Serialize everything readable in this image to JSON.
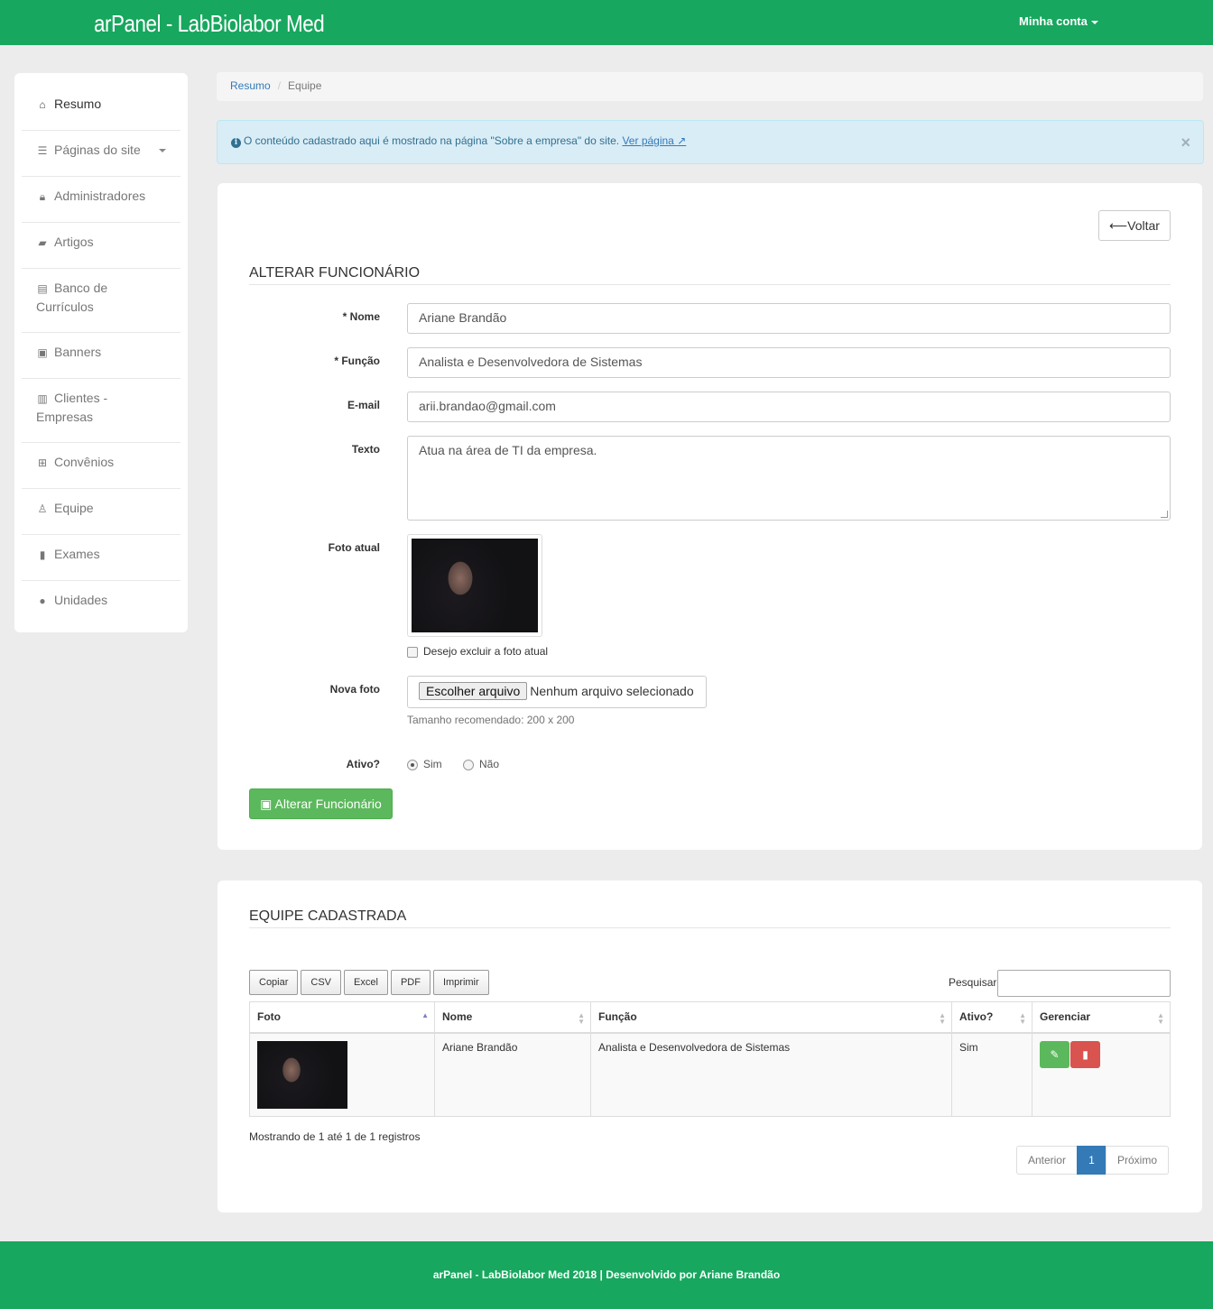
{
  "app": {
    "title": "arPanel - LabBiolabor Med",
    "account_label": "Minha conta"
  },
  "sidebar": {
    "items": [
      {
        "label": "Resumo",
        "icon": "home-icon"
      },
      {
        "label": "Páginas do site",
        "icon": "list-icon"
      },
      {
        "label": "Administradores",
        "icon": "lock-icon"
      },
      {
        "label": "Artigos",
        "icon": "book-icon"
      },
      {
        "label": "Banco de Currículos",
        "icon": "id-card-icon"
      },
      {
        "label": "Banners",
        "icon": "image-icon"
      },
      {
        "label": "Clientes - Empresas",
        "icon": "building-icon"
      },
      {
        "label": "Convênios",
        "icon": "medkit-icon"
      },
      {
        "label": "Equipe",
        "icon": "user-icon"
      },
      {
        "label": "Exames",
        "icon": "file-icon"
      },
      {
        "label": "Unidades",
        "icon": "globe-icon"
      }
    ]
  },
  "breadcrumb": {
    "home": "Resumo",
    "current": "Equipe"
  },
  "alert": {
    "text": "O conteúdo cadastrado aqui é mostrado na página \"Sobre a empresa\" do site.",
    "link": "Ver página",
    "close": "×"
  },
  "form": {
    "back_label": "Voltar",
    "title": "ALTERAR FUNCIONÁRIO",
    "nome_label": "* Nome",
    "nome_value": "Ariane Brandão",
    "funcao_label": "* Função",
    "funcao_value": "Analista e Desenvolvedora de Sistemas",
    "email_label": "E-mail",
    "email_value": "arii.brandao@gmail.com",
    "texto_label": "Texto",
    "texto_value": "Atua na área de TI da empresa.",
    "foto_label": "Foto atual",
    "excluir_label": "Desejo excluir a foto atual",
    "nova_foto_label": "Nova foto",
    "file_button": "Escolher arquivo",
    "file_status": "Nenhum arquivo selecionado",
    "file_help": "Tamanho recomendado: 200 x 200",
    "ativo_label": "Ativo?",
    "sim": "Sim",
    "nao": "Não",
    "submit_label": "Alterar Funcionário"
  },
  "team": {
    "title": "EQUIPE CADASTRADA",
    "export_buttons": [
      "Copiar",
      "CSV",
      "Excel",
      "PDF",
      "Imprimir"
    ],
    "search_label": "Pesquisar",
    "columns": [
      "Foto",
      "Nome",
      "Função",
      "Ativo?",
      "Gerenciar"
    ],
    "rows": [
      {
        "nome": "Ariane Brandão",
        "funcao": "Analista e Desenvolvedora de Sistemas",
        "ativo": "Sim"
      }
    ],
    "info": "Mostrando de 1 até 1 de 1 registros",
    "pager": {
      "prev": "Anterior",
      "page": "1",
      "next": "Próximo"
    }
  },
  "footer": {
    "text": "arPanel - LabBiolabor Med 2018 | Desenvolvido por Ariane Brandão"
  },
  "colors": {
    "brand_green": "#17a75e",
    "primary_blue": "#337ab7",
    "success_green": "#5cb85c",
    "danger_red": "#d9534f"
  }
}
